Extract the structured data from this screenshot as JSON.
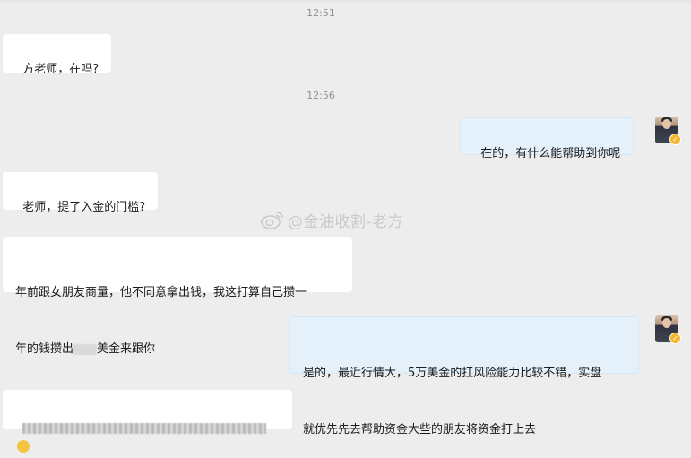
{
  "messages": {
    "t1": "12:51",
    "m1": "方老师，在吗?",
    "t2": "12:56",
    "m2": "在的，有什么能帮助到你呢",
    "m3": "老师，提了入金的门槛?",
    "m4_line1": "年前跟女朋友商量，他不同意拿出钱，我这打算自己攒一",
    "m4_line2a": "年的钱攒出",
    "m4_line2b": "美金来跟你",
    "m5_line1": "是的，最近行情大，5万美金的扛风险能力比较不错，实盘",
    "m5_line2": "就优先先去帮助资金大些的朋友将资金打上去"
  },
  "watermark": "@金油收割-老方",
  "colors": {
    "incoming_bubble": "#ffffff",
    "outgoing_bubble": "#e4f1fb",
    "background": "#ededed",
    "verified_badge": "#f5b52c"
  }
}
